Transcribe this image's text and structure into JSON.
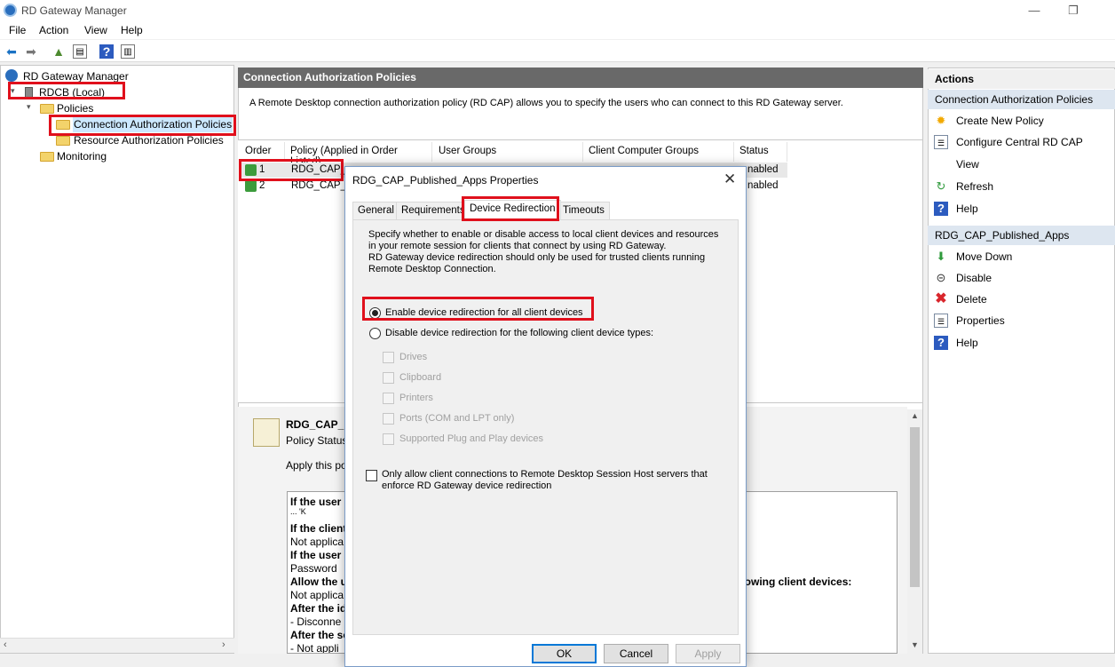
{
  "window": {
    "title": "RD Gateway Manager",
    "min": "—",
    "max": "❐"
  },
  "menu": [
    "File",
    "Action",
    "View",
    "Help"
  ],
  "tree": {
    "root": "RD Gateway Manager",
    "server": "RDCB (Local)",
    "policies": "Policies",
    "cap": "Connection Authorization Policies",
    "rap": "Resource Authorization Policies",
    "monitoring": "Monitoring"
  },
  "center": {
    "header": "Connection Authorization Policies",
    "description": "A Remote Desktop connection authorization policy (RD CAP) allows you to specify the users who can connect to this RD Gateway server.",
    "columns": [
      "Order",
      "Policy (Applied in Order Listed)",
      "User Groups",
      "Client Computer Groups",
      "Status"
    ],
    "rows": [
      {
        "order": "1",
        "policy": "RDG_CAP_",
        "status": "nabled"
      },
      {
        "order": "2",
        "policy": "RDG_CAP_A",
        "status": "nabled"
      }
    ],
    "details": {
      "name": "RDG_CAP_P",
      "status": "Policy Status",
      "apply": "Apply this poi",
      "lines": [
        {
          "text": "If the user",
          "bold": true
        },
        {
          "text": "... 'K",
          "bold": false
        },
        {
          "text": "If the client",
          "bold": true
        },
        {
          "text": "Not applica",
          "bold": false
        },
        {
          "text": "If the user",
          "bold": true
        },
        {
          "text": "Password",
          "bold": false
        },
        {
          "text": "Allow the u",
          "bold": true
        },
        {
          "text": "Not applica",
          "bold": false
        },
        {
          "text": "After the id",
          "bold": true
        },
        {
          "text": " - Disconne",
          "bold": false
        },
        {
          "text": "After the se",
          "bold": true
        },
        {
          "text": " - Not appli",
          "bold": false
        }
      ],
      "right_text": "llowing client devices:"
    }
  },
  "actions": {
    "header": "Actions",
    "section1": "Connection Authorization Policies",
    "items1": [
      "Create New Policy",
      "Configure Central RD CAP",
      "View",
      "Refresh",
      "Help"
    ],
    "section2": "RDG_CAP_Published_Apps",
    "items2": [
      "Move Down",
      "Disable",
      "Delete",
      "Properties",
      "Help"
    ]
  },
  "dialog": {
    "title": "RDG_CAP_Published_Apps Properties",
    "tabs": [
      "General",
      "Requirements",
      "Device Redirection",
      "Timeouts"
    ],
    "selected_tab": "Device Redirection",
    "intro1": "Specify whether to enable or disable access  to local client devices and resources in your remote session for clients that connect by using RD Gateway.",
    "intro2": "RD Gateway device redirection should only be used for trusted clients running Remote Desktop Connection.",
    "radio_enable": "Enable device redirection for all client devices",
    "radio_disable": "Disable device redirection for the following client device types:",
    "devices": [
      "Drives",
      "Clipboard",
      "Printers",
      "Ports (COM and LPT only)",
      "Supported Plug and Play devices"
    ],
    "only_allow": "Only allow client connections to Remote Desktop Session Host servers that enforce RD Gateway device redirection",
    "buttons": {
      "ok": "OK",
      "cancel": "Cancel",
      "apply": "Apply"
    }
  },
  "colors": {
    "highlight_red": "#e0101c",
    "header_gray": "#696969",
    "selected_blue": "#cce8ff",
    "section_bg": "#dde6f0"
  }
}
